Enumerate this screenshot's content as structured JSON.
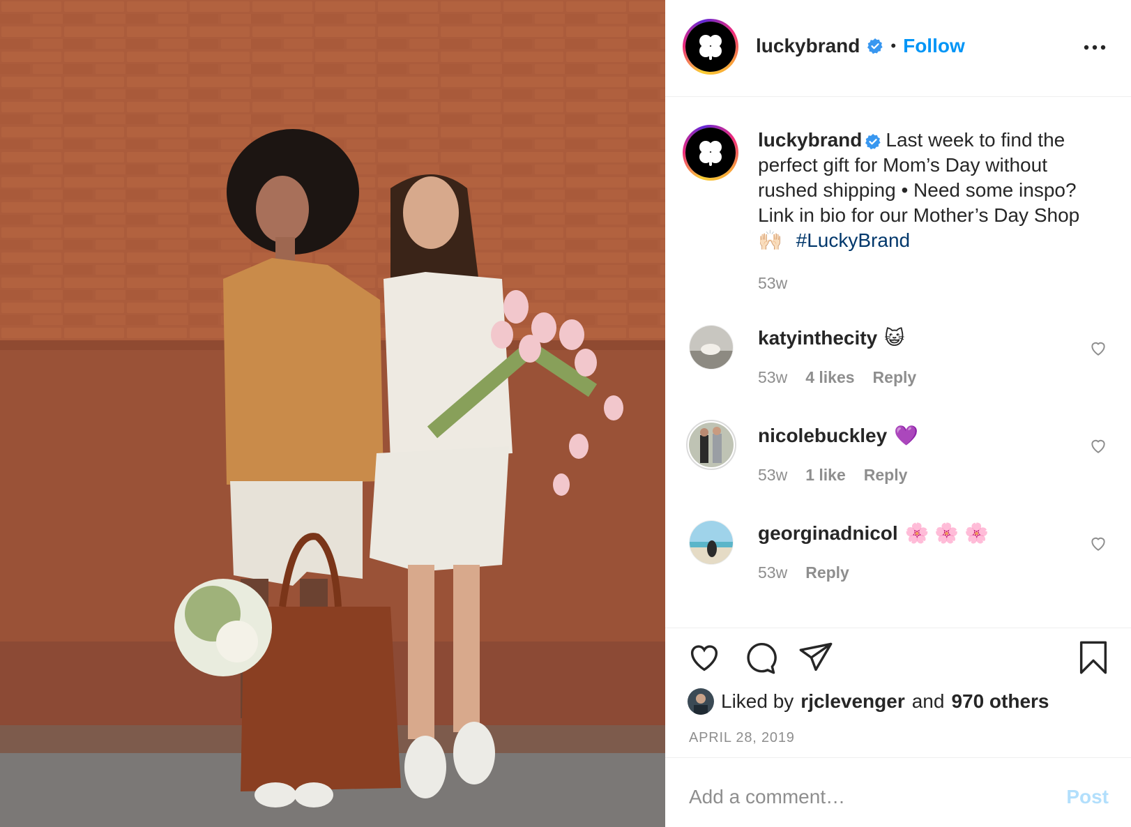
{
  "colors": {
    "follow_blue": "#0095f6",
    "hashtag": "#00376b",
    "secondary_text": "#8e8e8e",
    "post_disabled": "#b2dffc",
    "verified": "#3897f0"
  },
  "header": {
    "username": "luckybrand",
    "separator": "•",
    "follow_label": "Follow",
    "more_icon": "more-options-icon"
  },
  "caption": {
    "username": "luckybrand",
    "text": "Last week to find the perfect gift for Mom’s Day without rushed shipping • Need some inspo? Link in bio for our Mother’s Day Shop",
    "emoji": "🙌🏻",
    "hashtag": "#LuckyBrand",
    "time": "53w"
  },
  "comments": [
    {
      "username": "katyinthecity",
      "text": "😺",
      "time": "53w",
      "likes": "4 likes",
      "reply": "Reply"
    },
    {
      "username": "nicolebuckley",
      "text": "💜",
      "time": "53w",
      "likes": "1 like",
      "reply": "Reply"
    },
    {
      "username": "georginadnicol",
      "text": "🌸 🌸 🌸",
      "time": "53w",
      "reply": "Reply"
    }
  ],
  "actions": {
    "like_icon": "heart-icon",
    "comment_icon": "comment-icon",
    "share_icon": "share-icon",
    "save_icon": "bookmark-icon"
  },
  "likes": {
    "prefix": "Liked by",
    "user": "rjclevenger",
    "and": "and",
    "others": "970 others"
  },
  "date": "APRIL 28, 2019",
  "add_comment": {
    "placeholder": "Add a comment…",
    "post_label": "Post"
  }
}
